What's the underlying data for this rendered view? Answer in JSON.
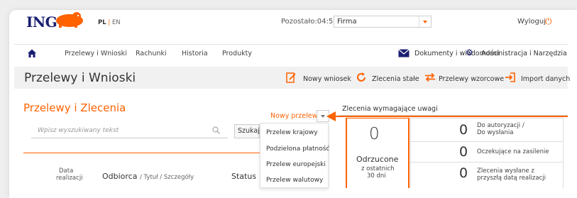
{
  "header": {
    "logo_text": "ING",
    "lang_active": "PL",
    "lang_sep": "|",
    "lang_other": "EN",
    "remaining_label": "Pozostało:04:56",
    "firm_value": "Firma",
    "logout_label": "Wyloguj",
    "brand_color": "#ff6200",
    "brand_navy": "#1a1f71"
  },
  "nav": {
    "items": [
      "Przelewy i Wnioski",
      "Rachunki",
      "Historia",
      "Produkty"
    ],
    "docs_label": "Dokumenty i wiadomości",
    "admin_label": "Administracja i Narzędzia"
  },
  "titlebar": {
    "title": "Przelewy i Wnioski",
    "actions": [
      "Nowy wniosek",
      "Zlecenia stałe",
      "Przelewy wzorcowe",
      "Import danych"
    ]
  },
  "left": {
    "section_title": "Przelewy i Zlecenia",
    "search_placeholder": "Wpisz wyszukiwany tekst",
    "search_button": "Szukaj",
    "col_date_1": "Data",
    "col_date_2": "realizacji",
    "col_recipient": "Odbiorca",
    "col_recipient_sub": "/ Tytuł / Szczegóły",
    "col_status": "Status"
  },
  "dropdown": {
    "trigger": "Nowy przelew",
    "items": [
      "Przelew krajowy",
      "Podzielona płatność",
      "Przelew europejski",
      "Przelew walutowy"
    ]
  },
  "right": {
    "title": "Zlecenia wymagające uwagi",
    "rejected_count": "0",
    "rejected_label": "Odrzucone",
    "rejected_sub1": "z ostatnich",
    "rejected_sub2": "30 dni",
    "rows": [
      {
        "count": "0",
        "line1": "Do autoryzacji /",
        "line2": "Do wysłania"
      },
      {
        "count": "0",
        "line1": "Oczekujące na zasilenie",
        "line2": ""
      },
      {
        "count": "0",
        "line1": "Zlecenia wysłane z",
        "line2": "przyszłą datą realizacji"
      }
    ]
  }
}
